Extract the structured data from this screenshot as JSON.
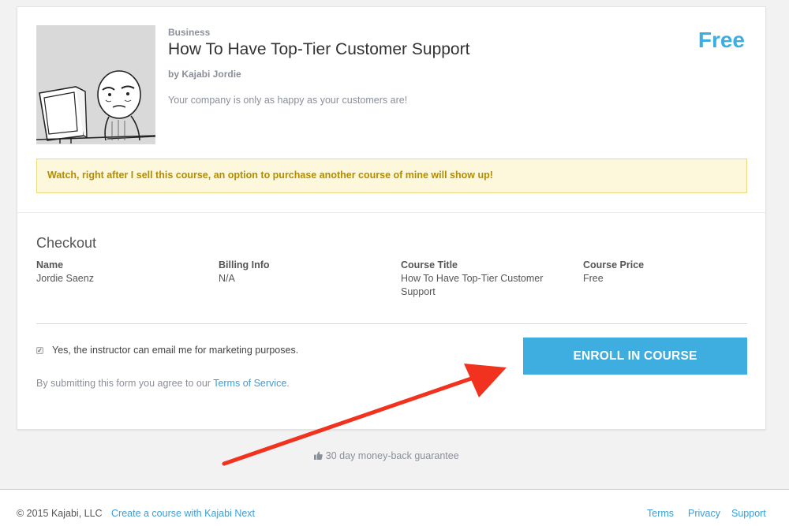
{
  "course": {
    "category": "Business",
    "title": "How To Have Top-Tier Customer Support",
    "author": "by Kajabi Jordie",
    "description": "Your company is only as happy as your customers are!",
    "price": "Free",
    "thumbnail_icon": "rage-comic-computer-guy-illustration"
  },
  "notice": "Watch, right after I sell this course, an option to purchase another course of mine will show up!",
  "checkout": {
    "title": "Checkout",
    "columns": [
      {
        "label": "Name",
        "value": "Jordie Saenz"
      },
      {
        "label": "Billing Info",
        "value": "N/A"
      },
      {
        "label": "Course Title",
        "value": "How To Have Top-Tier Customer Support"
      },
      {
        "label": "Course Price",
        "value": "Free"
      }
    ],
    "consent_label": "Yes, the instructor can email me for marketing purposes.",
    "consent_checked": true,
    "tos_prefix": "By submitting this form you agree to our ",
    "tos_link": "Terms of Service",
    "tos_suffix": ".",
    "enroll_button": "ENROLL IN COURSE"
  },
  "guarantee": {
    "icon": "thumbs-up-icon",
    "text": "30 day money-back guarantee"
  },
  "footer": {
    "copyright": "© 2015 Kajabi, LLC",
    "create_link": "Create a course with Kajabi Next",
    "terms": "Terms",
    "privacy": "Privacy",
    "support": "Support"
  },
  "colors": {
    "accent": "#3eaee0",
    "link": "#3b9ed6",
    "notice_bg": "#fdf8dc",
    "notice_text": "#b48c00",
    "annotation_arrow": "#f0321e"
  }
}
